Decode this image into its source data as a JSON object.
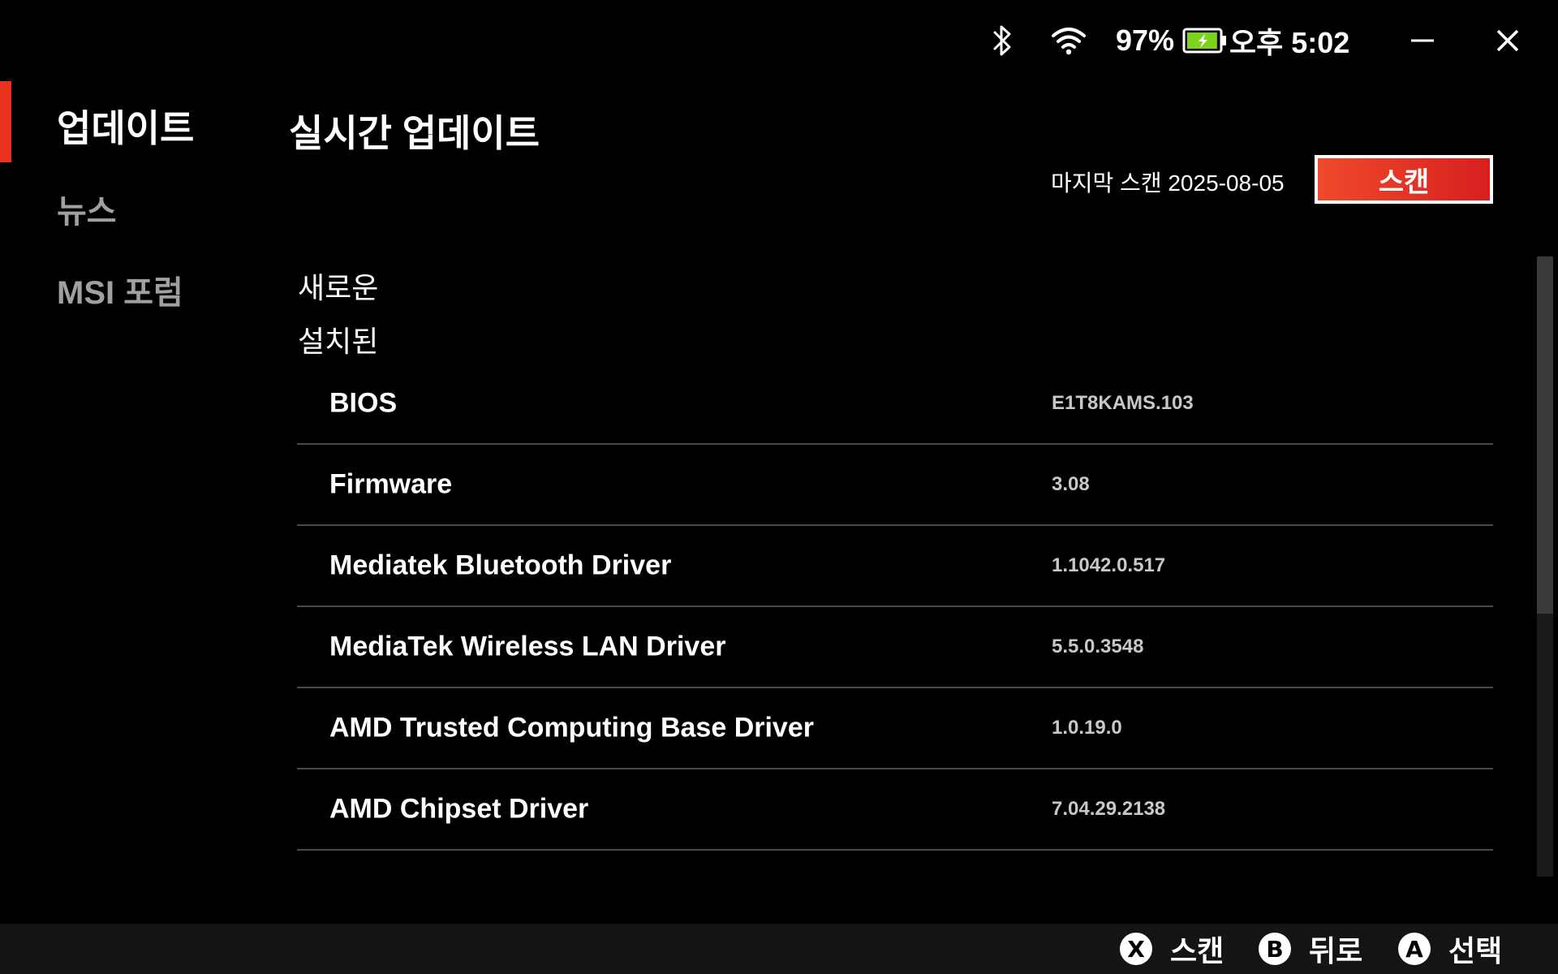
{
  "status_bar": {
    "battery_percent": "97%",
    "battery_level": 0.97,
    "clock": "오후 5:02"
  },
  "sidebar": {
    "items": [
      {
        "label": "업데이트",
        "active": true
      },
      {
        "label": "뉴스",
        "active": false
      },
      {
        "label": "MSI 포럼",
        "active": false
      }
    ]
  },
  "main": {
    "title": "실시간 업데이트",
    "last_scan_label": "마지막 스캔 2025-08-05",
    "scan_button_label": "스캔",
    "sections": {
      "new": "새로운",
      "installed": "설치된"
    },
    "drivers": [
      {
        "name": "BIOS",
        "version": "E1T8KAMS.103"
      },
      {
        "name": "Firmware",
        "version": "3.08"
      },
      {
        "name": "Mediatek Bluetooth Driver",
        "version": "1.1042.0.517"
      },
      {
        "name": "MediaTek Wireless LAN Driver",
        "version": "5.5.0.3548"
      },
      {
        "name": "AMD Trusted Computing Base Driver",
        "version": "1.0.19.0"
      },
      {
        "name": "AMD Chipset Driver",
        "version": "7.04.29.2138"
      }
    ]
  },
  "bottom_bar": {
    "hints": [
      {
        "button": "X",
        "label": "스캔"
      },
      {
        "button": "B",
        "label": "뒤로"
      },
      {
        "button": "A",
        "label": "선택"
      }
    ]
  },
  "colors": {
    "accent": "#e8321f",
    "background": "#000000",
    "battery_fill": "#7ed321"
  },
  "icons": {
    "bluetooth": "bluetooth-icon",
    "wifi": "wifi-icon",
    "battery": "battery-charging-icon",
    "minimize": "minimize-icon",
    "close": "close-icon"
  }
}
